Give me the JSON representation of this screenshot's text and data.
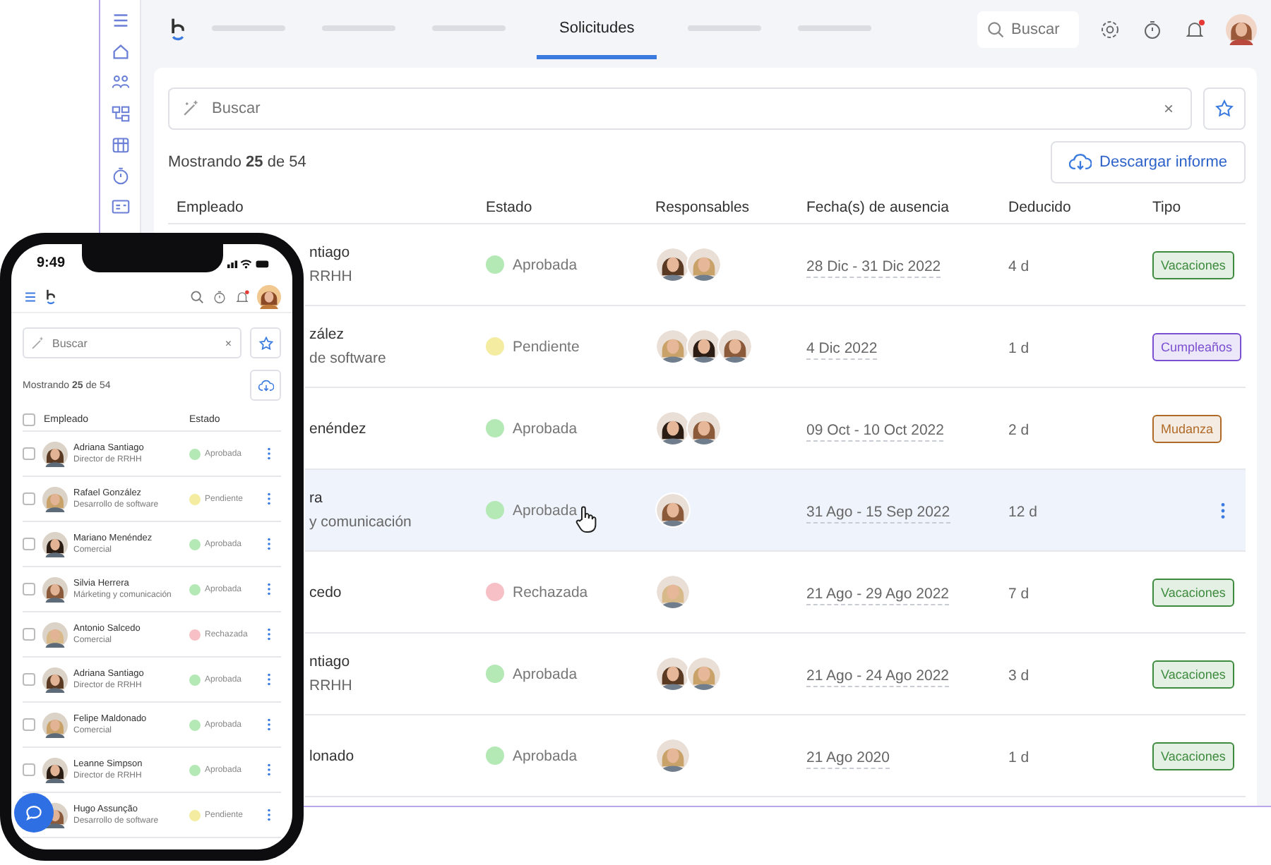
{
  "sidebar": {
    "items": [
      {
        "kind": "menu"
      },
      {
        "kind": "home"
      },
      {
        "kind": "people"
      },
      {
        "kind": "org"
      },
      {
        "kind": "calendar"
      },
      {
        "kind": "timer"
      },
      {
        "kind": "card"
      }
    ]
  },
  "tabs": [
    {
      "kind": "placeholder",
      "selected": false
    },
    {
      "kind": "placeholder",
      "selected": false
    },
    {
      "kind": "placeholder",
      "selected": false
    },
    {
      "kind": "tab",
      "label": "Solicitudes",
      "selected": true
    },
    {
      "kind": "placeholder",
      "selected": false
    },
    {
      "kind": "placeholder",
      "selected": false
    }
  ],
  "top_search": {
    "placeholder": "Buscar"
  },
  "notifications": {
    "unread": true
  },
  "filter": {
    "placeholder": "Buscar",
    "clear": "×"
  },
  "count": "Mostrando **25** de 54",
  "download_button": "Descargar informe",
  "table": {
    "columns": [
      "Empleado",
      "Estado",
      "Responsables",
      "Fecha(s) de ausencia",
      "Deducido",
      "Tipo"
    ],
    "rows": [
      {
        "name": "ntiago",
        "role": "RRHH",
        "status": {
          "label": "Aprobada",
          "color": "#b4e8b4"
        },
        "dates": "28 Dic - 31 Dic 2022",
        "deducted": "4 d",
        "type": {
          "label": "Vacaciones",
          "color": "#3d8b3d"
        },
        "selected": false
      },
      {
        "name": "zález",
        "role": "de software",
        "status": {
          "label": "Pendiente",
          "color": "#f4eca0"
        },
        "dates": "4 Dic 2022",
        "deducted": "1 d",
        "type": {
          "label": "Cumpleaños",
          "color": "#7a4fd0"
        },
        "selected": false
      },
      {
        "name": "enéndez",
        "status": {
          "label": "Aprobada",
          "color": "#b4e8b4"
        },
        "dates": "09 Oct - 10 Oct 2022",
        "deducted": "2 d",
        "type": {
          "label": "Mudanza",
          "color": "#b06a28"
        },
        "selected": false
      },
      {
        "name": "ra",
        "role": "y comunicación",
        "status": {
          "label": "Aprobada",
          "color": "#b4e8b4"
        },
        "dates": "31 Ago - 15 Sep 2022",
        "deducted": "12 d",
        "selected": true
      },
      {
        "name": "cedo",
        "status": {
          "label": "Rechazada",
          "color": "#f6c0c6"
        },
        "dates": "21 Ago - 29 Ago 2022",
        "deducted": "7 d",
        "type": {
          "label": "Vacaciones",
          "color": "#3d8b3d"
        },
        "selected": false
      },
      {
        "name": "ntiago",
        "role": "RRHH",
        "status": {
          "label": "Aprobada",
          "color": "#b4e8b4"
        },
        "dates": "21 Ago - 24 Ago 2022",
        "deducted": "3 d",
        "type": {
          "label": "Vacaciones",
          "color": "#3d8b3d"
        },
        "selected": false
      },
      {
        "name": "lonado",
        "status": {
          "label": "Aprobada",
          "color": "#b4e8b4"
        },
        "dates": "21 Ago 2020",
        "deducted": "1 d",
        "type": {
          "label": "Vacaciones",
          "color": "#3d8b3d"
        },
        "selected": false
      }
    ]
  },
  "phone": {
    "time": "9:49",
    "search": {
      "placeholder": "Buscar",
      "clear": "×"
    },
    "count": "Mostrando **25** de 54",
    "notifications": {
      "unread": true
    },
    "columns": [
      "Empleado",
      "Estado"
    ],
    "header_checked": false,
    "rows": [
      {
        "name": "Adriana Santiago",
        "role": "Director de RRHH",
        "status": {
          "label": "Aprobada",
          "color": "#b4e8b4"
        },
        "checked": false
      },
      {
        "name": "Rafael González",
        "role": "Desarrollo de software",
        "status": {
          "label": "Pendiente",
          "color": "#f4eca0"
        },
        "checked": false
      },
      {
        "name": "Mariano Menéndez",
        "role": "Comercial",
        "status": {
          "label": "Aprobada",
          "color": "#b4e8b4"
        },
        "checked": false
      },
      {
        "name": "Silvia Herrera",
        "role": "Márketing y comunicación",
        "status": {
          "label": "Aprobada",
          "color": "#b4e8b4"
        },
        "checked": false
      },
      {
        "name": "Antonio Salcedo",
        "role": "Comercial",
        "status": {
          "label": "Rechazada",
          "color": "#f6c0c6"
        },
        "checked": false
      },
      {
        "name": "Adriana Santiago",
        "role": "Director de RRHH",
        "status": {
          "label": "Aprobada",
          "color": "#b4e8b4"
        },
        "checked": false
      },
      {
        "name": "Felipe Maldonado",
        "role": "Comercial",
        "status": {
          "label": "Aprobada",
          "color": "#b4e8b4"
        },
        "checked": false
      },
      {
        "name": "Leanne Simpson",
        "role": "Director de RRHH",
        "status": {
          "label": "Aprobada",
          "color": "#b4e8b4"
        },
        "checked": false
      },
      {
        "name": "Hugo Assunção",
        "role": "Desarrollo de software",
        "status": {
          "label": "Pendiente",
          "color": "#f4eca0"
        }
      }
    ]
  }
}
